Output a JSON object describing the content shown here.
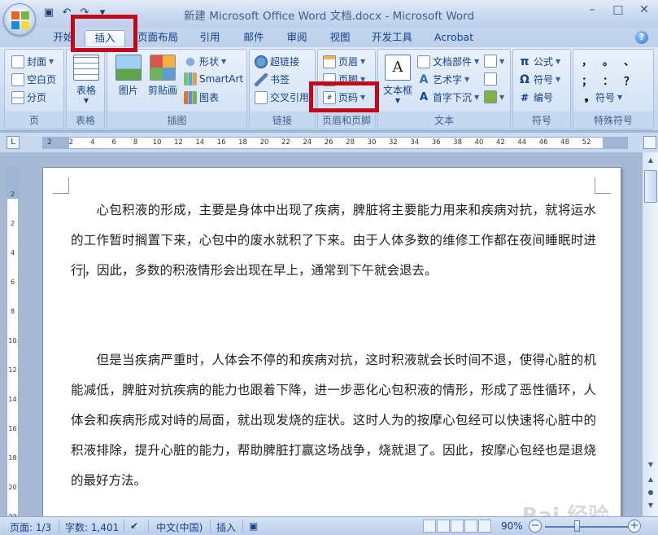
{
  "window": {
    "title": "新建 Microsoft Office Word 文档.docx - Microsoft Word",
    "controls": [
      "–",
      "□",
      "✕"
    ]
  },
  "tabs": [
    {
      "label": "开始",
      "active": false
    },
    {
      "label": "插入",
      "active": true
    },
    {
      "label": "页面布局",
      "active": false
    },
    {
      "label": "引用",
      "active": false
    },
    {
      "label": "邮件",
      "active": false
    },
    {
      "label": "审阅",
      "active": false
    },
    {
      "label": "视图",
      "active": false
    },
    {
      "label": "开发工具",
      "active": false
    },
    {
      "label": "Acrobat",
      "active": false
    }
  ],
  "ribbon": {
    "pages": {
      "label": "页",
      "cover": "封面",
      "blank": "空白页",
      "break": "分页"
    },
    "table": {
      "label": "表格",
      "table": "表格"
    },
    "illustrations": {
      "label": "插图",
      "picture": "图片",
      "clipart": "剪贴画",
      "shapes": "形状",
      "smartart": "SmartArt",
      "chart": "图表"
    },
    "links": {
      "label": "链接",
      "hyperlink": "超链接",
      "bookmark": "书签",
      "crossref": "交叉引用"
    },
    "header_footer": {
      "label": "页眉和页脚",
      "header": "页眉",
      "footer": "页脚",
      "page_number": "页码"
    },
    "text": {
      "label": "文本",
      "textbox": "文本框",
      "quickparts": "文档部件",
      "wordart": "艺术字",
      "dropcap": "首字下沉"
    },
    "symbols": {
      "label": "符号",
      "equation": "公式",
      "symbol": "符号",
      "number": "编号"
    },
    "special": {
      "label": "特殊符号",
      "row1": [
        "，",
        "。",
        "、"
      ],
      "row2": [
        "；",
        "：",
        "？"
      ],
      "symbol": "符号"
    }
  },
  "ruler": {
    "ticks": [
      "2",
      "2",
      "4",
      "6",
      "8",
      "10",
      "12",
      "14",
      "16",
      "18",
      "20",
      "22",
      "24",
      "26",
      "28",
      "30",
      "32",
      "34",
      "36",
      "38",
      "40",
      "42",
      "44",
      "46",
      "48",
      "52"
    ],
    "vticks": [
      "2",
      "2",
      "4",
      "6",
      "8",
      "10",
      "12",
      "14",
      "16",
      "18",
      "20",
      "22"
    ]
  },
  "document": {
    "para1_before_caret": "　　心包积液的形成，主要是身体中出现了疾病，脾脏将主要能力用来和疾病对抗，就将运水的工作暂时搁置下来，心包中的废水就积了下来。由于人体多数的维修工作都在夜间睡眠时进行",
    "para1_after_caret": "，因此，多数的积液情形会出现在早上，通常到下午就会退去。",
    "para2": "　　但是当疾病严重时，人体会不停的和疾病对抗，这时积液就会长时间不退，使得心脏的机能减低，脾脏对抗疾病的能力也跟着下降，进一步恶化心包积液的情形，形成了恶性循环，人体会和疾病形成对峙的局面，就出现发烧的症状。这时人为的按摩心包经可以快速将心脏中的积液排除，提升心脏的能力，帮助脾脏打赢这场战争，烧就退了。因此，按摩心包经也是退烧的最好方法。",
    "watermark": "Bai 经验"
  },
  "status": {
    "page": "页面: 1/3",
    "words": "字数: 1,401",
    "language": "中文(中国)",
    "mode": "插入",
    "zoom": "90%",
    "zoom_level": 0.9
  },
  "colors": {
    "highlight": "#c4081a",
    "ribbon": "#d4e3f5",
    "text": "#15428b"
  }
}
